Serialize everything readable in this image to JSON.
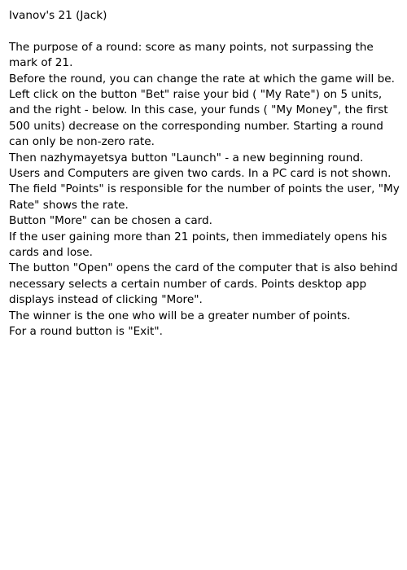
{
  "title": "Ivanov's 21 (Jack)",
  "paragraphs": [
    "The purpose of a round: score as many points, not surpassing the mark of 21.",
    "Before the round, you can change the rate at which the game will be. Left click on the button \"Bet\" raise your bid ( \"My Rate\") on 5 units, and the right - below. In this case, your funds ( \"My Money\", the first 500 units) decrease on the corresponding number. Starting a round can only be non-zero rate.",
    "Then nazhymayetsya button \"Launch\" - a new beginning round.",
    "Users and Computers are given two cards. In a PC card is not shown.",
    "The field \"Points\" is responsible for the number of points the user, \"My Rate\" shows the rate.",
    "Button \"More\" can be chosen a card.",
    "If the user gaining more than 21 points, then immediately opens his cards and lose.",
    "The button \"Open\" opens the card of the computer that is also behind necessary selects a certain number of cards. Points desktop app displays instead of clicking \"More\".",
    "The winner is the one who will be a greater number of points.",
    "For a round button is \"Exit\"."
  ]
}
